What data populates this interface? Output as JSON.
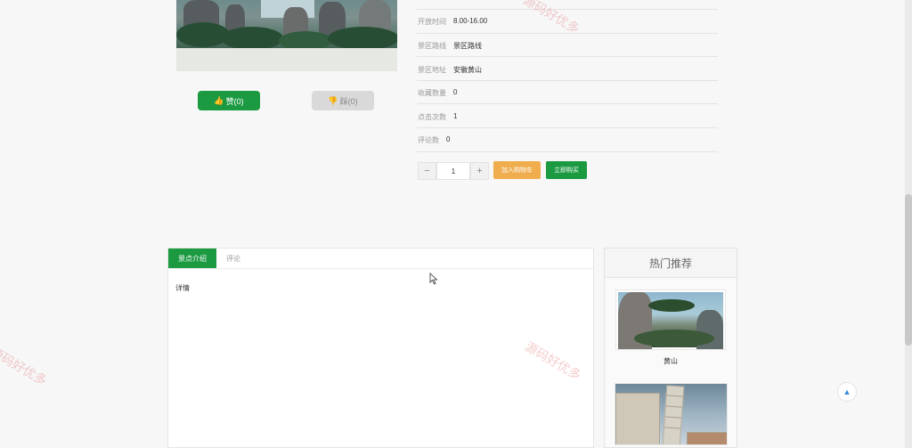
{
  "vote": {
    "like_label": "赞(0)",
    "dislike_label": "踩(0)"
  },
  "info_rows": [
    {
      "label": "开放时间",
      "value": "8.00-16.00"
    },
    {
      "label": "景区路线",
      "value": "景区路线"
    },
    {
      "label": "景区地址",
      "value": "安徽黄山"
    },
    {
      "label": "收藏数量",
      "value": "0"
    },
    {
      "label": "点击次数",
      "value": "1"
    },
    {
      "label": "评论数",
      "value": "0"
    }
  ],
  "purchase": {
    "minus": "−",
    "quantity": "1",
    "plus": "+",
    "add_to_cart": "加入购物车",
    "buy_now": "立即购买"
  },
  "tabs": {
    "intro": "景点介绍",
    "comments": "评论"
  },
  "detail_text": "详情",
  "hot": {
    "title": "热门推荐",
    "items": [
      {
        "name": "黄山"
      }
    ]
  },
  "watermark": "源码好优多",
  "colors": {
    "primary_green": "#1b9a42",
    "cart_orange": "#f0ad4e"
  }
}
